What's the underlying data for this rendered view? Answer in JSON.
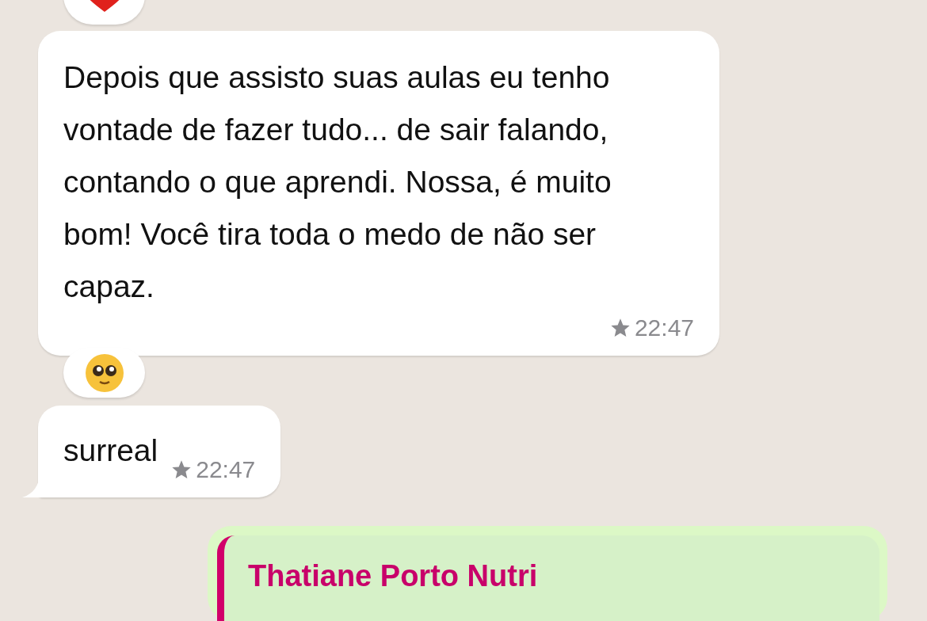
{
  "messages": [
    {
      "kind": "heart_reaction"
    },
    {
      "kind": "incoming",
      "text": "Depois que assisto suas aulas eu tenho vontade de fazer tudo... de sair falando, contando o que aprendi. Nossa, é muito bom! Você tira toda o medo de não ser capaz.",
      "time": "22:47",
      "starred": true,
      "tail": false
    },
    {
      "kind": "pleading_reaction"
    },
    {
      "kind": "incoming",
      "text": "surreal",
      "time": "22:47",
      "starred": true,
      "tail": true
    },
    {
      "kind": "outgoing_quote",
      "quote_author": "Thatiane Porto Nutri"
    }
  ]
}
